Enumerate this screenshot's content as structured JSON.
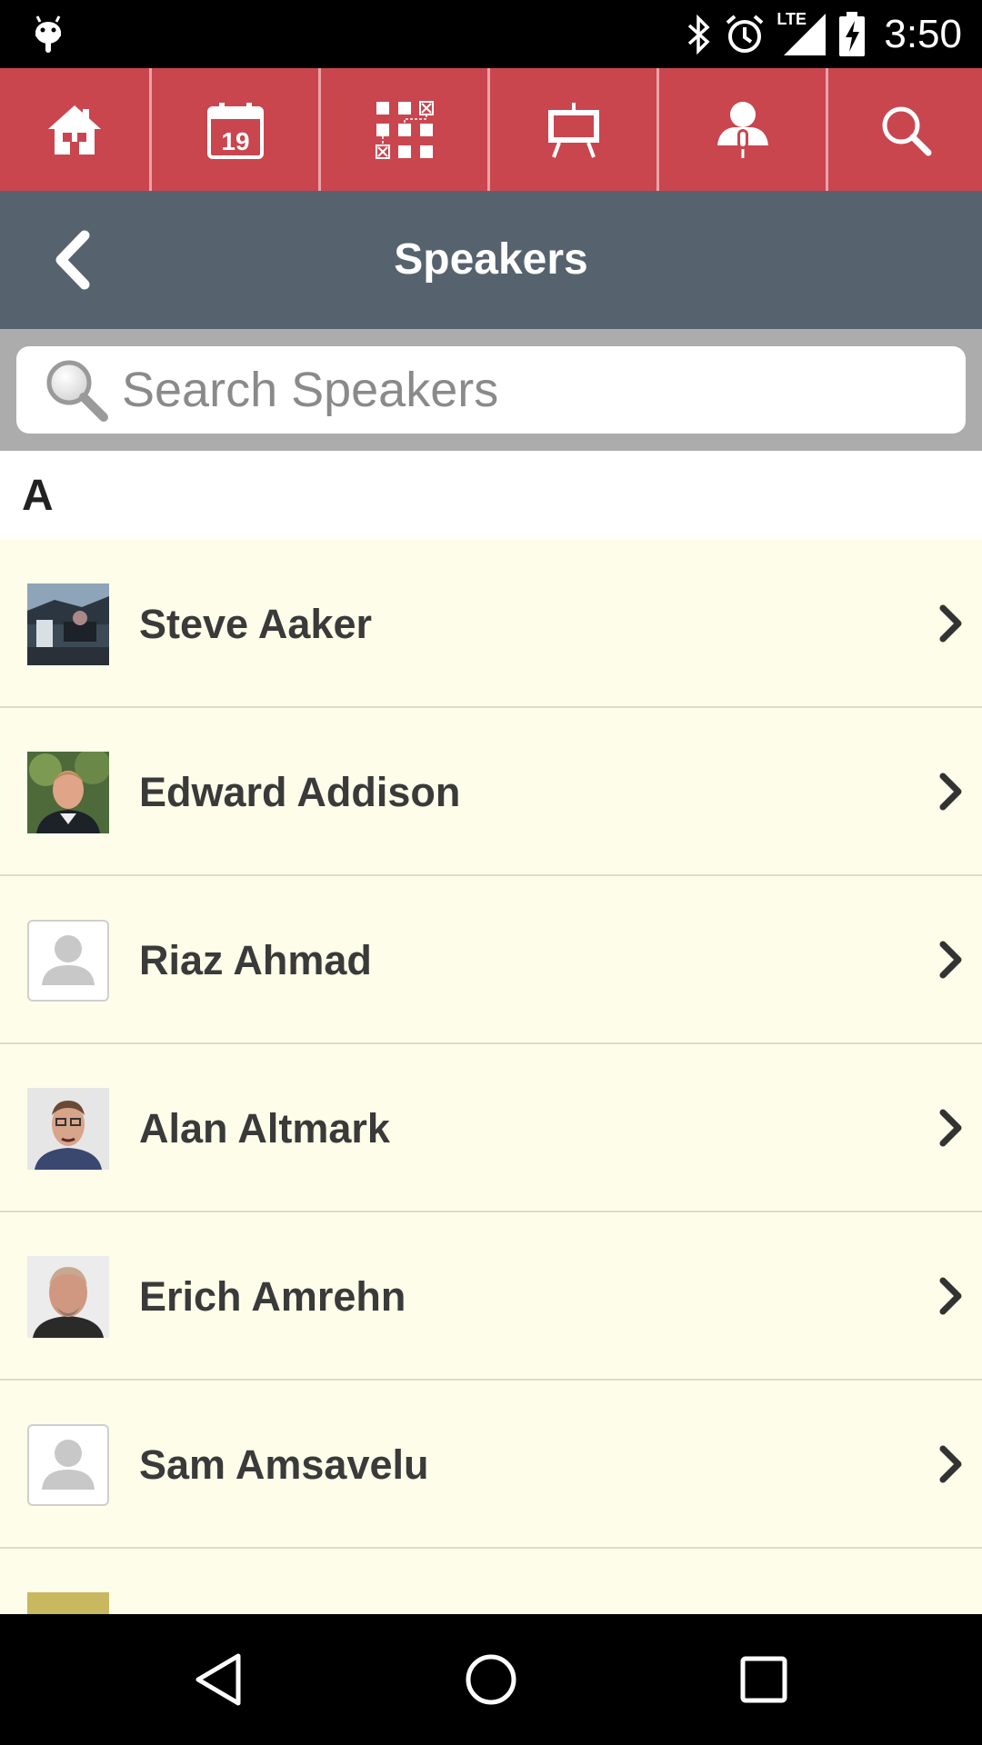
{
  "status_bar": {
    "time": "3:50",
    "network_label": "LTE",
    "icons": [
      "android-debug-icon",
      "bluetooth-icon",
      "alarm-icon",
      "lte-signal-icon",
      "battery-charging-icon"
    ]
  },
  "top_nav": {
    "background_color": "#c9464f",
    "items": [
      {
        "icon": "home-icon"
      },
      {
        "icon": "calendar-icon",
        "calendar_day": "19"
      },
      {
        "icon": "floor-plan-icon"
      },
      {
        "icon": "presentation-board-icon"
      },
      {
        "icon": "speaker-icon"
      },
      {
        "icon": "search-icon"
      }
    ]
  },
  "title_bar": {
    "title": "Speakers",
    "background_color": "#56636e"
  },
  "search": {
    "placeholder": "Search Speakers",
    "value": ""
  },
  "list": {
    "section_letter": "A",
    "background_color": "#fdfde9",
    "speakers": [
      {
        "name": "Steve Aaker",
        "avatar": "photo-outdoor"
      },
      {
        "name": "Edward Addison",
        "avatar": "photo-portrait"
      },
      {
        "name": "Riaz Ahmad",
        "avatar": "placeholder"
      },
      {
        "name": "Alan Altmark",
        "avatar": "photo-portrait"
      },
      {
        "name": "Erich Amrehn",
        "avatar": "photo-portrait"
      },
      {
        "name": "Sam Amsavelu",
        "avatar": "placeholder"
      },
      {
        "name": "",
        "avatar": "photo-group"
      }
    ]
  },
  "system_nav": {
    "buttons": [
      "back-triangle-icon",
      "home-circle-icon",
      "recents-square-icon"
    ]
  }
}
